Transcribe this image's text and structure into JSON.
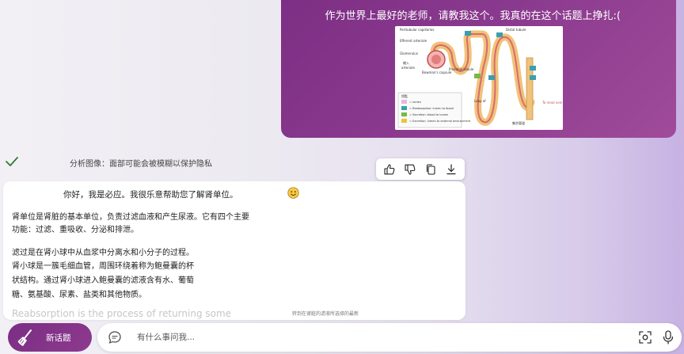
{
  "user_message": {
    "text": "作为世界上最好的老师，请教我这个。我真的在这个话题上挣扎:(",
    "image": {
      "labels": {
        "peritubular": "Peritubular capillaries",
        "distal": "Distal tubule",
        "efferent": "Efferent arteriole",
        "glomerulus": "Glomerulus",
        "afferent_cn": "输入",
        "afferent": "arteriole",
        "bowman": "Bowman's capsule",
        "proximal": "Proximal tubule",
        "loop": "Loop of",
        "renal_vein": "To renal vein",
        "collecting": "集合管道"
      },
      "legend": {
        "title": "钥匙",
        "items": [
          "= lumen",
          "= Reabsorption: lumen to blood",
          "= Secretion: blood to lumen",
          "= Excretion: lumen to external environment"
        ]
      }
    }
  },
  "analysis": {
    "text": "分析图像：面部可能会被模糊以保护隐私",
    "check_color": "#2e7d32"
  },
  "response": {
    "greeting": "你好，我是必应。我很乐意帮助您了解肾单位。",
    "paragraphs": [
      [
        "肾单位是肾脏的基本单位，负责过滤血液和产生尿液。它有四个主要",
        "功能：过滤、重吸收、分泌和排泄。"
      ],
      [
        "滤过是在肾小球中从血浆中分离水和小分子的过程。",
        "肾小球是一簇毛细血管，周围环绕着称为鲍曼囊的杯",
        "状结构。通过肾小球进入鲍曼囊的滤液含有水、葡萄",
        "糖、氨基酸、尿素、盐类和其他物质。"
      ]
    ],
    "faded_text": "Reabsorption is the process of returning some"
  },
  "scroll_hint": "转到在肾脏的滤液所选择的最新",
  "bottom": {
    "new_topic": "新话题",
    "input_placeholder": "有什么事问我..."
  },
  "colors": {
    "accent": "#7d2f85",
    "white": "#ffffff"
  },
  "icons": {
    "toolbar": [
      "thumbs-up-icon",
      "thumbs-down-icon",
      "copy-icon",
      "download-icon"
    ]
  }
}
